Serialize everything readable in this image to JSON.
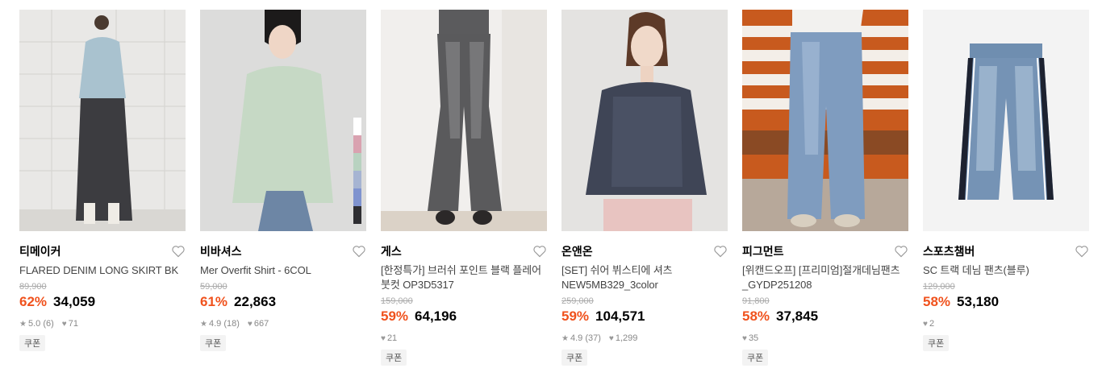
{
  "products": [
    {
      "brand": "티메이커",
      "title": "FLARED DENIM LONG SKIRT BK",
      "original_price": "89,900",
      "discount": "62%",
      "price": "34,059",
      "rating": "5.0 (6)",
      "likes": "71",
      "coupon": "쿠폰",
      "image": "woman-denim-skirt"
    },
    {
      "brand": "비바셔스",
      "title": "Mer Overfit Shirt - 6COL",
      "original_price": "59,000",
      "discount": "61%",
      "price": "22,863",
      "rating": "4.9 (18)",
      "likes": "667",
      "coupon": "쿠폰",
      "image": "woman-green-shirt",
      "swatch_colors": [
        "#ffffff",
        "#d9a2b0",
        "#b8d2c0",
        "#a6b4d2",
        "#7f93cf",
        "#2e2e32"
      ]
    },
    {
      "brand": "게스",
      "title": "[한정특가] 브러쉬 포인트 블랙 플레어 붓컷 OP3D5317",
      "original_price": "159,000",
      "discount": "59%",
      "price": "64,196",
      "rating": "",
      "likes": "21",
      "coupon": "쿠폰",
      "image": "black-flare-jeans"
    },
    {
      "brand": "온앤온",
      "title": "[SET] 쉬어 뷔스티에 셔츠 NEW5MB329_3color",
      "original_price": "259,000",
      "discount": "59%",
      "price": "104,571",
      "rating": "4.9 (37)",
      "likes": "1,299",
      "coupon": "쿠폰",
      "image": "woman-navy-bustier"
    },
    {
      "brand": "피그먼트",
      "title": "[위캔드오프] [프리미엄]절개데님팬츠_GYDP251208",
      "original_price": "91,800",
      "discount": "58%",
      "price": "37,845",
      "rating": "",
      "likes": "35",
      "coupon": "쿠폰",
      "image": "blue-wide-jeans"
    },
    {
      "brand": "스포츠챔버",
      "title": "SC 트랙 데님 팬츠(블루)",
      "original_price": "129,000",
      "discount": "58%",
      "price": "53,180",
      "rating": "",
      "likes": "2",
      "coupon": "쿠폰",
      "image": "track-denim-pants"
    }
  ],
  "colors": {
    "discount": "#f0521d",
    "brand_text": "#000000",
    "muted": "#888888"
  },
  "icons": {
    "wishlist": "heart-outline-icon",
    "rating": "star-icon",
    "likes": "heart-icon"
  }
}
